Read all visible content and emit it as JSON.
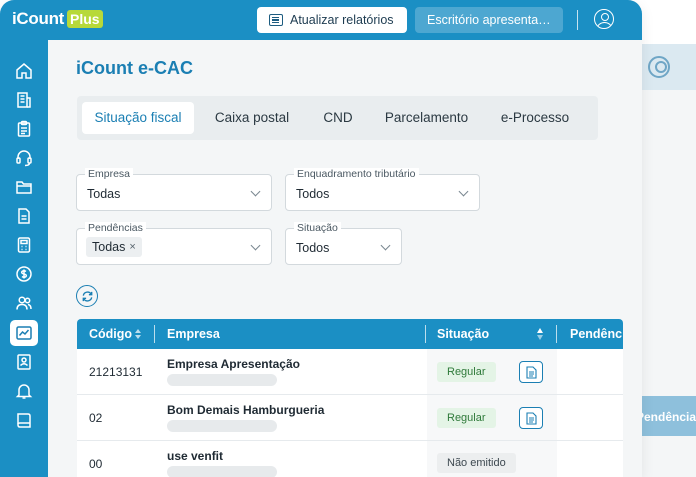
{
  "app": {
    "logo_main": "iCount",
    "logo_badge": "Plus"
  },
  "topbar": {
    "update_label": "Atualizar relatórios",
    "office_value": "Escritório apresentação"
  },
  "background_window": {
    "column_fragment": "Pendências"
  },
  "page": {
    "title": "iCount e-CAC"
  },
  "tabs": [
    {
      "label": "Situação fiscal",
      "active": true
    },
    {
      "label": "Caixa postal",
      "active": false
    },
    {
      "label": "CND",
      "active": false
    },
    {
      "label": "Parcelamento",
      "active": false
    },
    {
      "label": "e-Processo",
      "active": false
    }
  ],
  "filters": {
    "empresa": {
      "label": "Empresa",
      "value": "Todas"
    },
    "enquadramento": {
      "label": "Enquadramento tributário",
      "value": "Todos"
    },
    "pendencias": {
      "label": "Pendências",
      "chip": "Todas",
      "chip_remove": "×"
    },
    "situacao": {
      "label": "Situação",
      "value": "Todos"
    }
  },
  "table": {
    "columns": {
      "codigo": "Código",
      "empresa": "Empresa",
      "situacao": "Situação",
      "pendencias": "Pendências"
    },
    "rows": [
      {
        "codigo": "21213131",
        "empresa": "Empresa Apresentação",
        "situacao": "Regular",
        "status": "ok"
      },
      {
        "codigo": "02",
        "empresa": "Bom Demais Hamburgueria",
        "situacao": "Regular",
        "status": "ok"
      },
      {
        "codigo": "00",
        "empresa": "use venfit",
        "situacao": "Não emitido",
        "status": "none"
      }
    ]
  },
  "colors": {
    "primary": "#1b8fc4",
    "accent": "#b7d93a",
    "title": "#1b7fb3"
  },
  "icons": {
    "sidebar": [
      "home-icon",
      "building-icon",
      "clipboard-icon",
      "headset-icon",
      "folder-icon",
      "document-icon",
      "calculator-icon",
      "dollar-icon",
      "users-icon",
      "ecac-chart-icon",
      "user-document-icon",
      "bell-icon",
      "book-icon"
    ]
  }
}
